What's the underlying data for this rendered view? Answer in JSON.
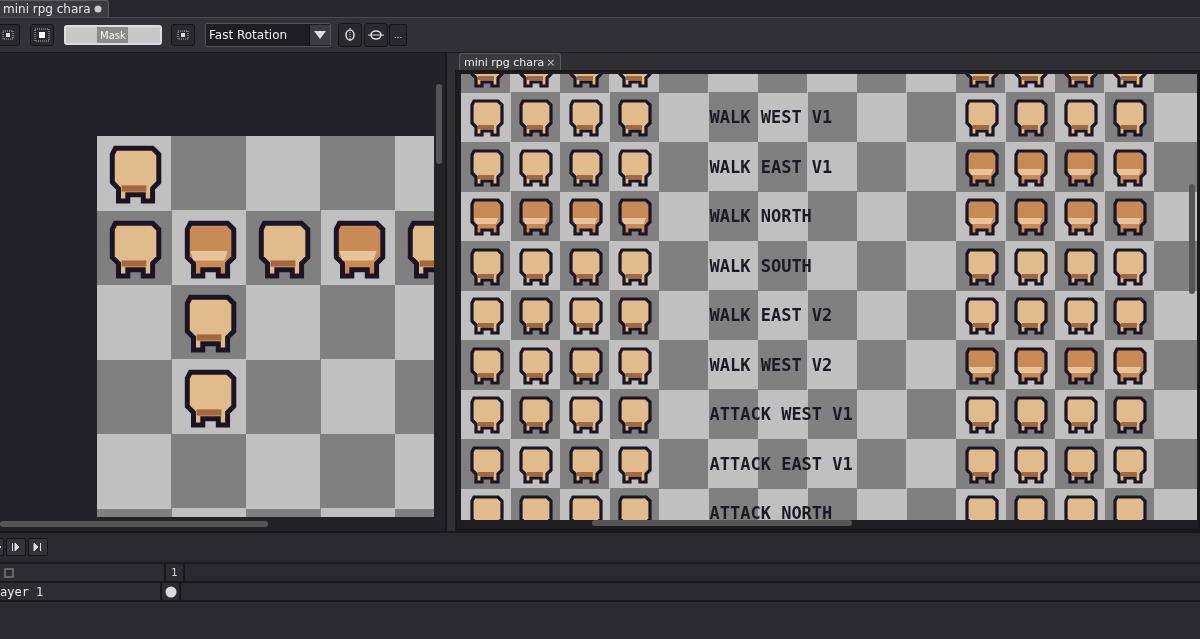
{
  "document_tab": {
    "title": "mini rpg chara",
    "modified": true
  },
  "toolbar": {
    "mask_button": "Mask",
    "rotation_dropdown": "Fast Rotation",
    "more_button": "..."
  },
  "editor_tab": {
    "title": "mini rpg chara",
    "close": "×"
  },
  "sprite_labels": [
    "WALK WEST V1",
    "WALK EAST V1",
    "WALK NORTH",
    "WALK SOUTH",
    "WALK EAST V2",
    "WALK WEST V2",
    "ATTACK WEST V1",
    "ATTACK EAST V1",
    "ATTACK NORTH"
  ],
  "timeline": {
    "layers": [
      {
        "name": "ayer 1"
      }
    ],
    "frames": [
      "1"
    ]
  }
}
